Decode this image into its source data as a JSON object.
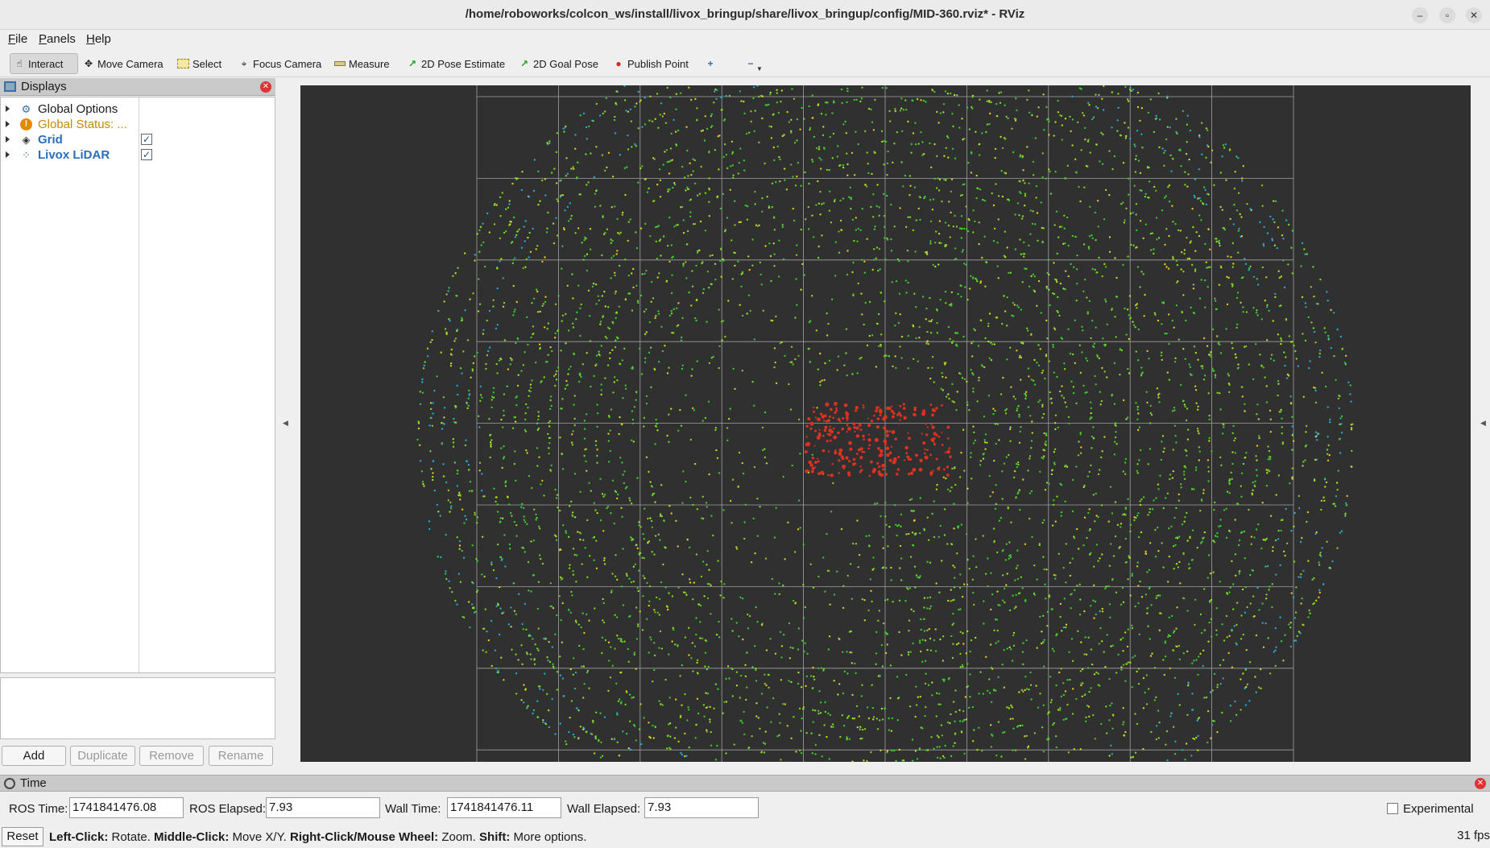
{
  "window": {
    "title": "/home/roboworks/colcon_ws/install/livox_bringup/share/livox_bringup/config/MID-360.rviz* - RViz",
    "minimize": "–",
    "maximize": "▫",
    "close": "✕"
  },
  "menu": {
    "file": {
      "prefix": "",
      "u": "F",
      "rest": "ile"
    },
    "panels": {
      "prefix": "",
      "u": "P",
      "rest": "anels"
    },
    "help": {
      "prefix": "",
      "u": "H",
      "rest": "elp"
    }
  },
  "toolbar": {
    "interact": "Interact",
    "move_camera": "Move Camera",
    "select": "Select",
    "focus_camera": "Focus Camera",
    "measure": "Measure",
    "pose_estimate": "2D Pose Estimate",
    "goal_pose": "2D Goal Pose",
    "publish_point": "Publish Point"
  },
  "displays": {
    "title": "Displays",
    "items": [
      {
        "label": "Global Options",
        "color": "#000000",
        "checked": null
      },
      {
        "label": "Global Status: ...",
        "color": "#c98a00",
        "checked": null
      },
      {
        "label": "Grid",
        "color": "#2a6ebb",
        "checked": true
      },
      {
        "label": "Livox LiDAR",
        "color": "#2a6ebb",
        "checked": true
      }
    ],
    "buttons": {
      "add": "Add",
      "duplicate": "Duplicate",
      "remove": "Remove",
      "rename": "Rename"
    }
  },
  "time": {
    "title": "Time",
    "ros_time_label": "ROS Time:",
    "ros_time": "1741841476.08",
    "ros_elapsed_label": "ROS Elapsed:",
    "ros_elapsed": "7.93",
    "wall_time_label": "Wall Time:",
    "wall_time": "1741841476.11",
    "wall_elapsed_label": "Wall Elapsed:",
    "wall_elapsed": "7.93",
    "experimental": "Experimental",
    "experimental_checked": false
  },
  "status": {
    "reset": "Reset",
    "hint_parts": [
      {
        "b": "Left-Click:",
        "t": " Rotate. "
      },
      {
        "b": "Middle-Click:",
        "t": " Move X/Y. "
      },
      {
        "b": "Right-Click/Mouse Wheel:",
        "t": " Zoom. "
      },
      {
        "b": "Shift:",
        "t": " More options."
      }
    ],
    "fps": "31 fps"
  },
  "viewport": {
    "background": "#303030",
    "grid_color": "#a0a0a0",
    "point_colors": [
      "#3cc832",
      "#7ad428",
      "#b4dc28",
      "#e6c828",
      "#e03020",
      "#28a8d0"
    ]
  }
}
